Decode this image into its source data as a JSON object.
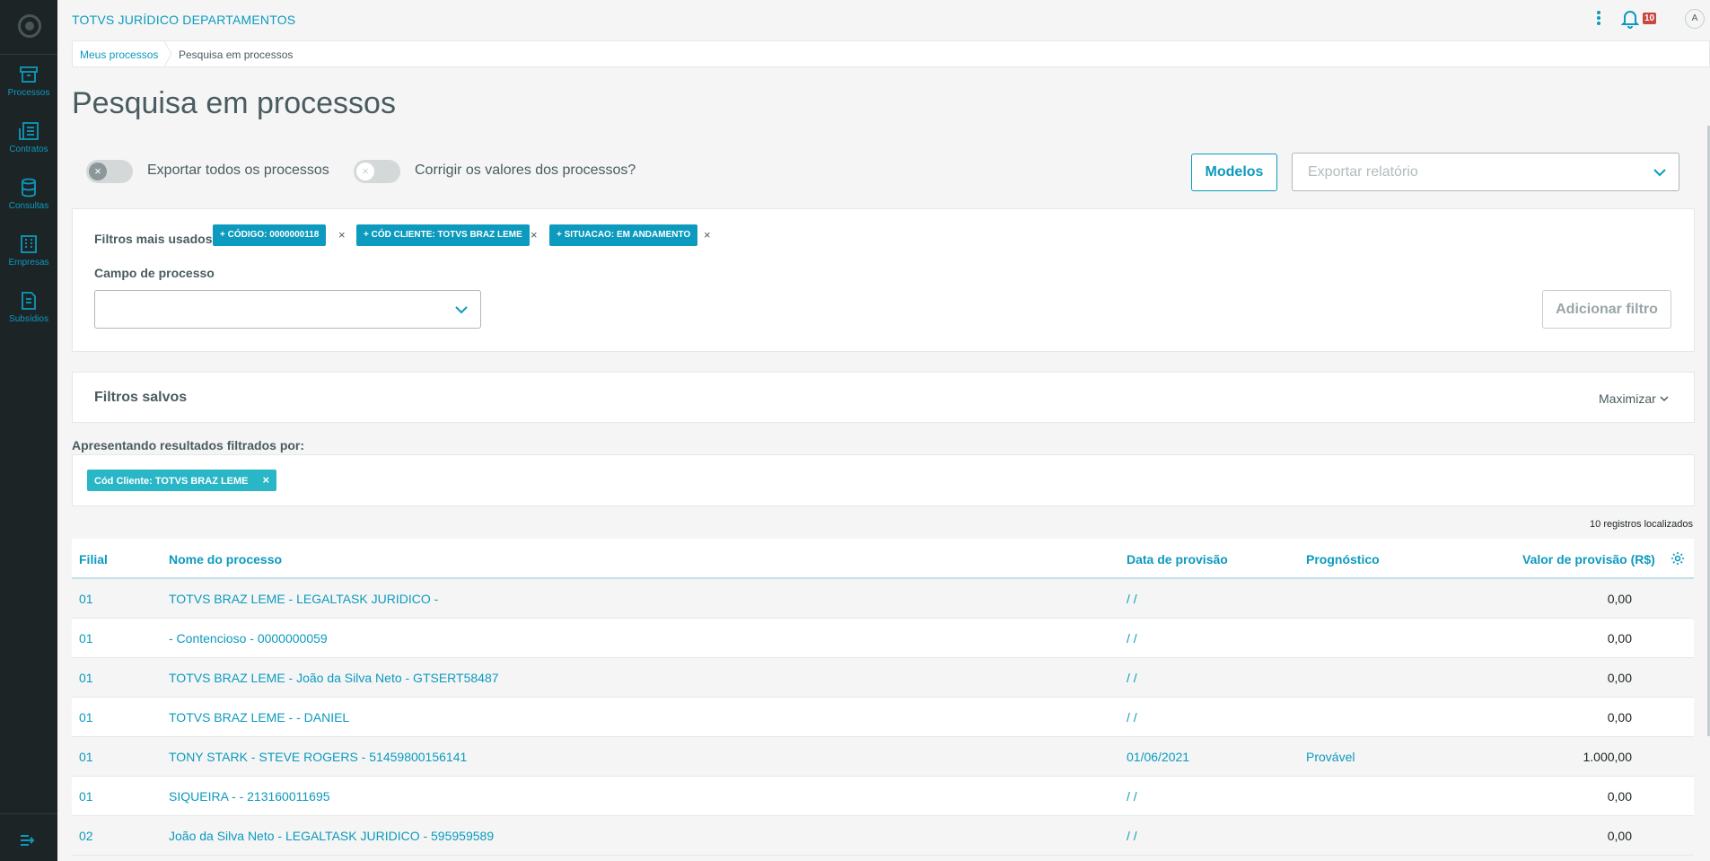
{
  "app": {
    "title": "TOTVS JURÍDICO DEPARTAMENTOS",
    "notifications": "10",
    "user_initial": "A"
  },
  "sidebar": {
    "items": [
      {
        "label": "Processos",
        "icon": "archive-icon"
      },
      {
        "label": "Contratos",
        "icon": "contracts-icon"
      },
      {
        "label": "Consultas",
        "icon": "database-icon"
      },
      {
        "label": "Empresas",
        "icon": "building-icon"
      },
      {
        "label": "Subsídios",
        "icon": "document-icon"
      }
    ]
  },
  "breadcrumb": {
    "items": [
      "Meus processos",
      "Pesquisa em processos"
    ]
  },
  "page": {
    "title": "Pesquisa em processos"
  },
  "options": {
    "export_all_label": "Exportar todos os processos",
    "correct_values_label": "Corrigir os valores dos processos?",
    "modelos_label": "Modelos",
    "export_report_placeholder": "Exportar relatório"
  },
  "filters": {
    "most_used_label": "Filtros mais usados",
    "chips": [
      "+ CÓDIGO: 0000000118",
      "+ CÓD CLIENTE: TOTVS BRAZ LEME",
      "+ SITUACAO: EM ANDAMENTO"
    ],
    "chip_remove": "×",
    "campo_label": "Campo de processo",
    "add_button": "Adicionar filtro"
  },
  "saved_filters": {
    "title": "Filtros salvos",
    "maximize_label": "Maximizar"
  },
  "results": {
    "label": "Apresentando resultados filtrados por:",
    "active_filter": "Cód Cliente: TOTVS BRAZ LEME",
    "active_filter_remove": "×",
    "count": "10 registros localizados"
  },
  "table": {
    "columns": [
      "Filial",
      "Nome do processo",
      "Data de provisão",
      "Prognóstico",
      "Valor de provisão (R$)"
    ],
    "rows": [
      {
        "filial": "01",
        "nome": "TOTVS BRAZ LEME - LEGALTASK JURIDICO -",
        "data": "/ /",
        "prognostico": "",
        "valor": "0,00"
      },
      {
        "filial": "01",
        "nome": "- Contencioso - 0000000059",
        "data": "/ /",
        "prognostico": "",
        "valor": "0,00"
      },
      {
        "filial": "01",
        "nome": "TOTVS BRAZ LEME - João da Silva Neto - GTSERT58487",
        "data": "/ /",
        "prognostico": "",
        "valor": "0,00"
      },
      {
        "filial": "01",
        "nome": "TOTVS BRAZ LEME - - DANIEL",
        "data": "/ /",
        "prognostico": "",
        "valor": "0,00"
      },
      {
        "filial": "01",
        "nome": "TONY STARK - STEVE ROGERS - 51459800156141",
        "data": "01/06/2021",
        "prognostico": "Provável",
        "valor": "1.000,00"
      },
      {
        "filial": "01",
        "nome": "SIQUEIRA - - 213160011695",
        "data": "/ /",
        "prognostico": "",
        "valor": "0,00"
      },
      {
        "filial": "02",
        "nome": "João da Silva Neto - LEGALTASK JURIDICO - 595959589",
        "data": "/ /",
        "prognostico": "",
        "valor": "0,00"
      }
    ]
  },
  "colors": {
    "primary": "#0c9abe",
    "sidebar": "#1d2426",
    "chip_active": "#29b6c6",
    "badge": "#c64840"
  }
}
